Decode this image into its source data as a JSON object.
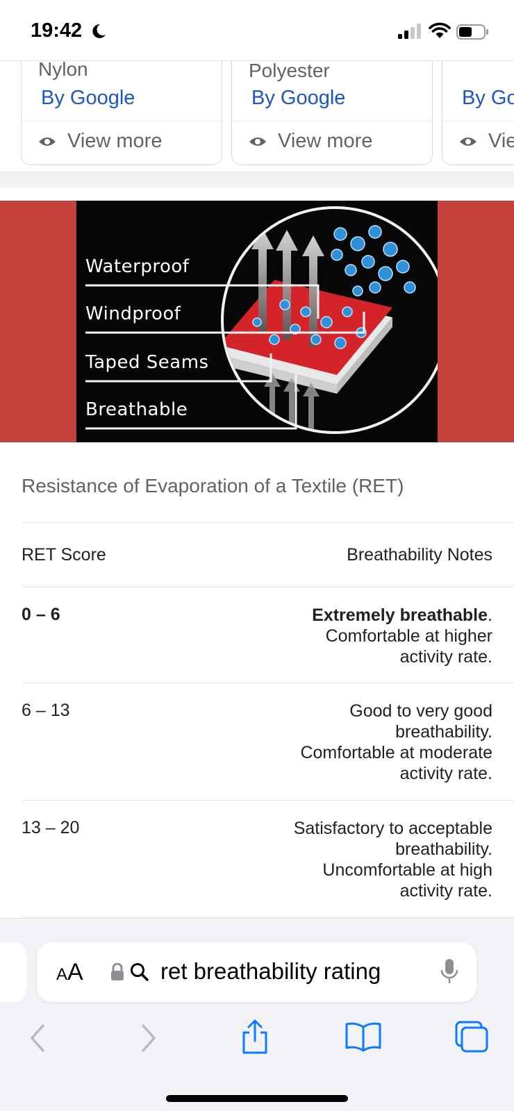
{
  "status_bar": {
    "time": "19:42"
  },
  "cards": [
    {
      "title": "Nylon",
      "by": "By Google",
      "more": "View more"
    },
    {
      "title": "Polyester",
      "by": "By Google",
      "more": "View more"
    },
    {
      "title": "",
      "by": "By Go",
      "more": "Vie"
    }
  ],
  "banner": {
    "labels": [
      "Waterproof",
      "Windproof",
      "Taped Seams",
      "Breathable"
    ]
  },
  "table": {
    "title": "Resistance of Evaporation of a Textile (RET)",
    "header": {
      "left": "RET Score",
      "right": "Breathability Notes"
    },
    "rows": [
      {
        "score": "0 – 6",
        "note_bold": "Extremely breathable",
        "note_rest": ". Comfortable at higher activity rate."
      },
      {
        "score": "6 – 13",
        "note": "Good to very good breathability. Comfortable at moderate activity rate."
      },
      {
        "score": "13 – 20",
        "note": "Satisfactory to acceptable breathability. Uncomfortable at high activity rate."
      }
    ]
  },
  "address_bar": {
    "aa_small": "A",
    "aa_large": "A",
    "query": "ret breathability rating"
  },
  "icons": {
    "eye": "eye-icon",
    "lock": "lock-icon",
    "search": "search-icon",
    "mic": "microphone-icon",
    "back": "chevron-left-icon",
    "forward": "chevron-right-icon",
    "share": "share-icon",
    "bookmarks": "book-icon",
    "tabs": "tabs-icon"
  },
  "colors": {
    "link": "#1a56c7",
    "banner_red": "#c4403b",
    "toolbar_tint": "#0a7aff"
  }
}
